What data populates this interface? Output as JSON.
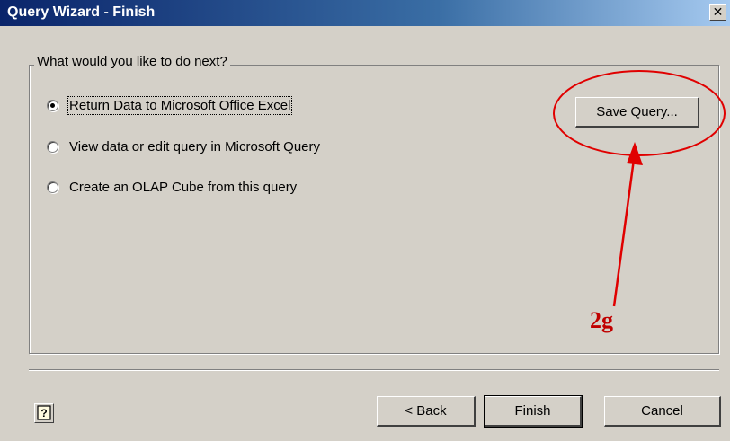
{
  "window": {
    "title": "Query Wizard - Finish",
    "close_glyph": "✕"
  },
  "group": {
    "legend": "What would you like to do next?"
  },
  "options": [
    {
      "label": "Return Data to Microsoft Office Excel",
      "checked": true
    },
    {
      "label": "View data or edit query in Microsoft Query",
      "checked": false
    },
    {
      "label": "Create an OLAP Cube from this query",
      "checked": false
    }
  ],
  "buttons": {
    "save_query": "Save Query...",
    "back": "< Back",
    "finish": "Finish",
    "cancel": "Cancel"
  },
  "annotation": {
    "label": "2g",
    "color": "#e00000"
  }
}
